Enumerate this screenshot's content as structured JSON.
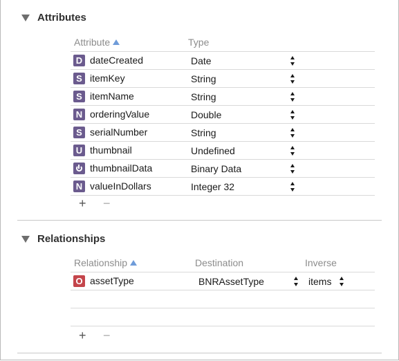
{
  "attributes": {
    "title": "Attributes",
    "columns": {
      "attribute": "Attribute",
      "type": "Type"
    },
    "rows": [
      {
        "badge": "D",
        "name": "dateCreated",
        "type": "Date"
      },
      {
        "badge": "S",
        "name": "itemKey",
        "type": "String"
      },
      {
        "badge": "S",
        "name": "itemName",
        "type": "String"
      },
      {
        "badge": "N",
        "name": "orderingValue",
        "type": "Double"
      },
      {
        "badge": "S",
        "name": "serialNumber",
        "type": "String"
      },
      {
        "badge": "U",
        "name": "thumbnail",
        "type": "Undefined"
      },
      {
        "badge": "power-icon",
        "name": "thumbnailData",
        "type": "Binary Data"
      },
      {
        "badge": "N",
        "name": "valueInDollars",
        "type": "Integer 32"
      }
    ],
    "add_label": "+",
    "remove_label": "−"
  },
  "relationships": {
    "title": "Relationships",
    "columns": {
      "relationship": "Relationship",
      "destination": "Destination",
      "inverse": "Inverse"
    },
    "rows": [
      {
        "badge": "O",
        "name": "assetType",
        "destination": "BNRAssetType",
        "inverse": "items"
      }
    ],
    "add_label": "+",
    "remove_label": "−"
  },
  "colors": {
    "attribute_badge": "#6b5b8e",
    "relationship_badge": "#c4454b",
    "sort_arrow": "#6f9cd9"
  }
}
